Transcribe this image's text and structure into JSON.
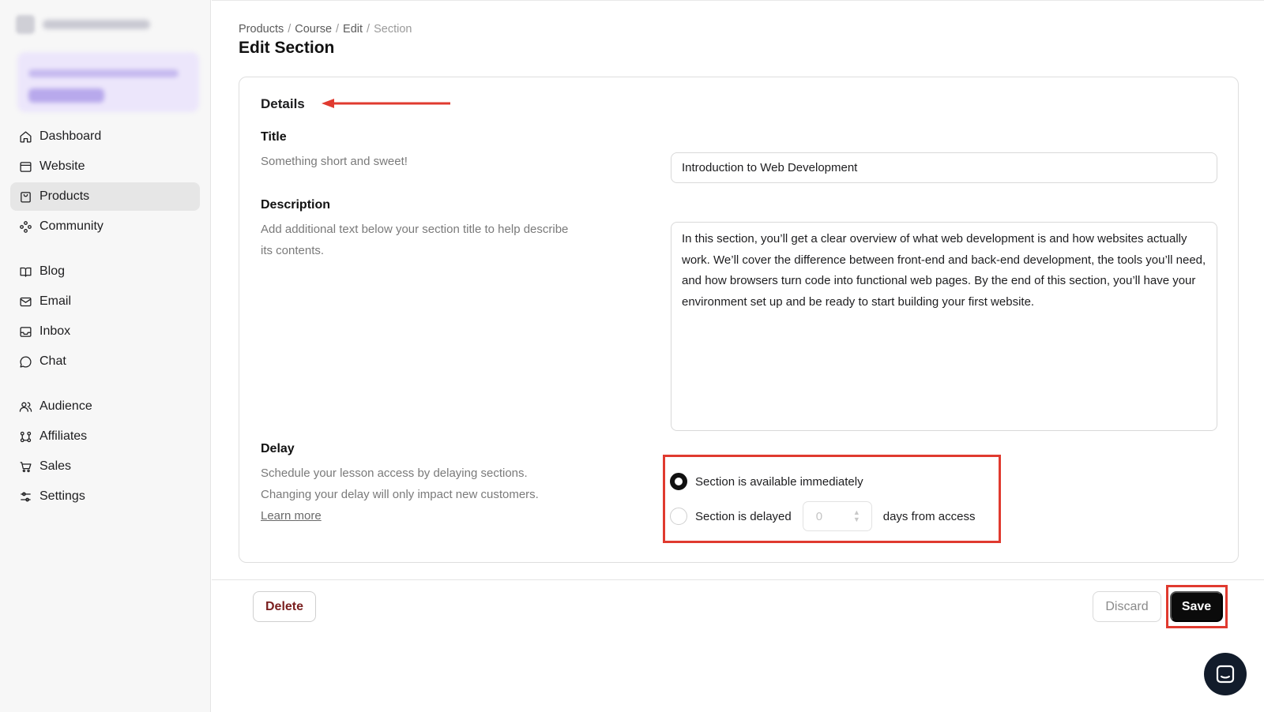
{
  "sidebar": {
    "brand": {
      "name": ""
    },
    "groups": [
      [
        {
          "label": "Dashboard",
          "icon": "home-icon",
          "active": false
        },
        {
          "label": "Website",
          "icon": "window-icon",
          "active": false
        },
        {
          "label": "Products",
          "icon": "bag-icon",
          "active": true
        },
        {
          "label": "Community",
          "icon": "community-icon",
          "active": false
        }
      ],
      [
        {
          "label": "Blog",
          "icon": "book-icon",
          "active": false
        },
        {
          "label": "Email",
          "icon": "mail-icon",
          "active": false
        },
        {
          "label": "Inbox",
          "icon": "inbox-icon",
          "active": false
        },
        {
          "label": "Chat",
          "icon": "chat-bubble-icon",
          "active": false
        }
      ],
      [
        {
          "label": "Audience",
          "icon": "users-icon",
          "active": false
        },
        {
          "label": "Affiliates",
          "icon": "affiliates-icon",
          "active": false
        },
        {
          "label": "Sales",
          "icon": "cart-icon",
          "active": false
        },
        {
          "label": "Settings",
          "icon": "sliders-icon",
          "active": false
        }
      ]
    ]
  },
  "breadcrumb": {
    "items": [
      "Products",
      "Course",
      "Edit"
    ],
    "current": "Section"
  },
  "page": {
    "title": "Edit Section"
  },
  "details": {
    "heading": "Details",
    "title_field": {
      "label": "Title",
      "help": "Something short and sweet!",
      "value": "Introduction to Web Development"
    },
    "description_field": {
      "label": "Description",
      "help": "Add additional text below your section title to help describe its contents.",
      "value": "In this section, you’ll get a clear overview of what web development is and how websites actually work. We’ll cover the difference between front-end and back-end development, the tools you’ll need, and how browsers turn code into functional web pages. By the end of this section, you’ll have your environment set up and be ready to start building your first website."
    },
    "delay": {
      "label": "Delay",
      "help": "Schedule your lesson access by delaying sections. Changing your delay will only impact new customers.",
      "learn_more": "Learn more",
      "option_immediate": "Section is available immediately",
      "option_delayed": "Section is delayed",
      "days_value": "0",
      "days_suffix": "days from access",
      "selected": "immediate"
    }
  },
  "footer": {
    "delete_label": "Delete",
    "discard_label": "Discard",
    "save_label": "Save"
  },
  "colors": {
    "accent": "#0b0b0b",
    "annotation": "#e03a2f",
    "chat_fab": "#121c2b"
  }
}
